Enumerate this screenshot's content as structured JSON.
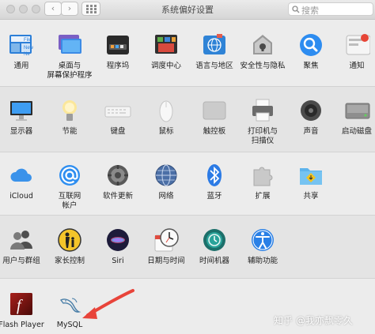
{
  "window": {
    "title": "系统偏好设置",
    "back_glyph": "‹",
    "forward_glyph": "›",
    "search_placeholder": "搜索"
  },
  "sections": [
    {
      "items": [
        {
          "label": "通用",
          "icon": "general-icon"
        },
        {
          "label": "桌面与\n屏幕保护程序",
          "icon": "desktop-screensaver-icon"
        },
        {
          "label": "程序坞",
          "icon": "dock-icon"
        },
        {
          "label": "调度中心",
          "icon": "mission-control-icon"
        },
        {
          "label": "语言与地区",
          "icon": "language-region-icon"
        },
        {
          "label": "安全性与隐私",
          "icon": "security-privacy-icon"
        },
        {
          "label": "聚焦",
          "icon": "spotlight-icon"
        },
        {
          "label": "通知",
          "icon": "notifications-icon"
        }
      ]
    },
    {
      "items": [
        {
          "label": "显示器",
          "icon": "displays-icon"
        },
        {
          "label": "节能",
          "icon": "energy-saver-icon"
        },
        {
          "label": "键盘",
          "icon": "keyboard-icon"
        },
        {
          "label": "鼠标",
          "icon": "mouse-icon"
        },
        {
          "label": "触控板",
          "icon": "trackpad-icon"
        },
        {
          "label": "打印机与\n扫描仪",
          "icon": "printers-scanners-icon"
        },
        {
          "label": "声音",
          "icon": "sound-icon"
        },
        {
          "label": "启动磁盘",
          "icon": "startup-disk-icon"
        }
      ]
    },
    {
      "items": [
        {
          "label": "iCloud",
          "icon": "icloud-icon"
        },
        {
          "label": "互联网\n帐户",
          "icon": "internet-accounts-icon"
        },
        {
          "label": "软件更新",
          "icon": "software-update-icon"
        },
        {
          "label": "网络",
          "icon": "network-icon"
        },
        {
          "label": "蓝牙",
          "icon": "bluetooth-icon"
        },
        {
          "label": "扩展",
          "icon": "extensions-icon"
        },
        {
          "label": "共享",
          "icon": "sharing-icon"
        }
      ]
    },
    {
      "items": [
        {
          "label": "用户与群组",
          "icon": "users-groups-icon"
        },
        {
          "label": "家长控制",
          "icon": "parental-controls-icon"
        },
        {
          "label": "Siri",
          "icon": "siri-icon"
        },
        {
          "label": "日期与时间",
          "icon": "date-time-icon"
        },
        {
          "label": "时间机器",
          "icon": "time-machine-icon"
        },
        {
          "label": "辅助功能",
          "icon": "accessibility-icon"
        }
      ]
    },
    {
      "items": [
        {
          "label": "Flash Player",
          "icon": "flash-player-icon"
        },
        {
          "label": "MySQL",
          "icon": "mysql-icon"
        }
      ]
    }
  ],
  "icon_glyphs": {
    "file_text": "File",
    "new_text": "New",
    "ne_text": "Ne",
    "flash_text": "f"
  },
  "watermark": "知乎 @我亦飘零久",
  "colors": {
    "arrow": "#e8443a",
    "window_bg": "#ececec",
    "accent": "#1a82fb"
  }
}
